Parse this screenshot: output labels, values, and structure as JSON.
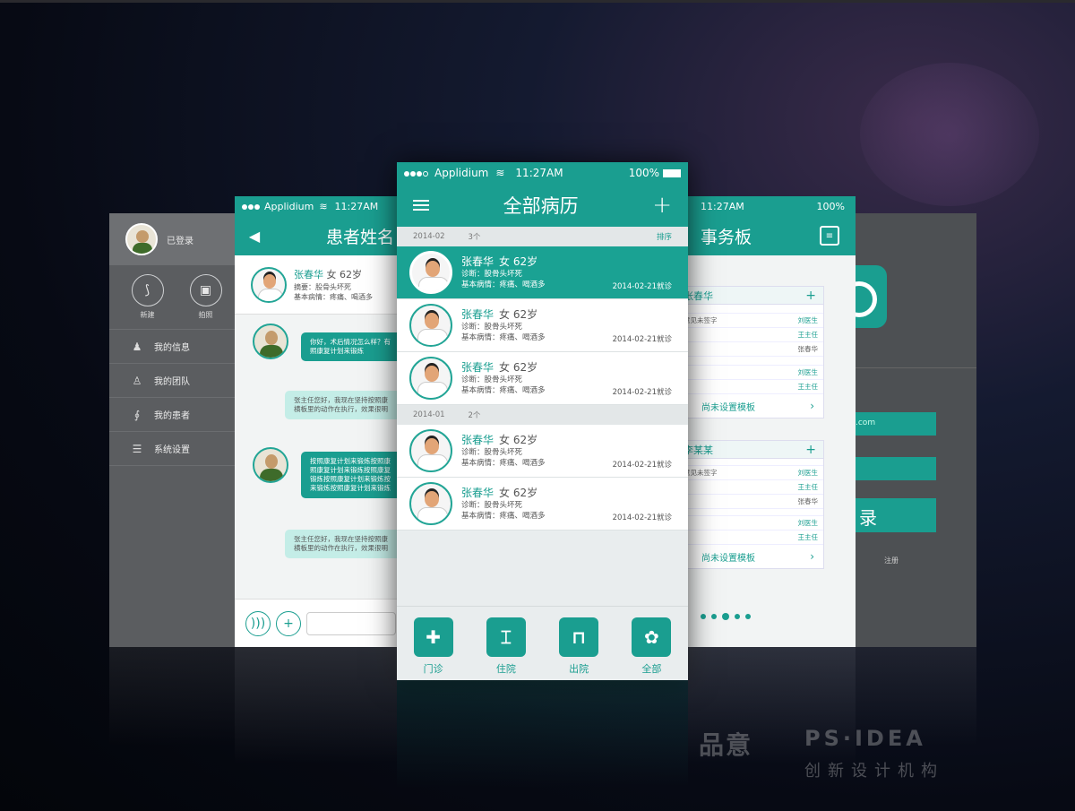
{
  "status": {
    "carrier": "Applidium",
    "time": "11:27AM",
    "battery": "100%"
  },
  "left_menu": {
    "login_label": "已登录",
    "quick": [
      {
        "label": "新建",
        "icon": "route-icon"
      },
      {
        "label": "拍照",
        "icon": "camera-icon"
      }
    ],
    "items": [
      {
        "label": "我的信息",
        "icon": "user-icon"
      },
      {
        "label": "我的团队",
        "icon": "team-icon"
      },
      {
        "label": "我的患者",
        "icon": "stethoscope-icon"
      },
      {
        "label": "系统设置",
        "icon": "settings-icon"
      }
    ]
  },
  "chat": {
    "title": "患者姓名",
    "patient": {
      "name": "张春华",
      "gender_age": "女 62岁",
      "summary": "摘要：股骨头坏死",
      "condition": "基本病情：疼痛、喝酒多"
    },
    "messages": [
      {
        "dir": "in",
        "lines": [
          "你好，术后情况怎么样？有",
          "照康复计划来锻炼"
        ]
      },
      {
        "dir": "out",
        "lines": [
          "张主任您好，我现在坚持按照康",
          "横板里的动作在执行，效果很明"
        ]
      },
      {
        "dir": "in",
        "lines": [
          "按照康复计划来锻炼按照康",
          "照康复计划来锻炼按照康复",
          "锻炼按照康复计划来锻炼按",
          "来锻炼按照康复计划来锻炼"
        ]
      },
      {
        "dir": "out",
        "lines": [
          "张主任您好，我现在坚持按照康",
          "横板里的动作在执行，效果很明"
        ]
      }
    ]
  },
  "main": {
    "title": "全部病历",
    "sections": [
      {
        "date": "2014-02",
        "count": "3个",
        "sort": "排序",
        "records": [
          {
            "name": "张春华",
            "ga": "女  62岁",
            "diag": "诊断：股骨头坏死",
            "cond": "基本病情：疼痛、喝酒多",
            "date": "2014-02-21就诊"
          },
          {
            "name": "张春华",
            "ga": "女  62岁",
            "diag": "诊断：股骨头坏死",
            "cond": "基本病情：疼痛、喝酒多",
            "date": "2014-02-21就诊"
          },
          {
            "name": "张春华",
            "ga": "女  62岁",
            "diag": "诊断：股骨头坏死",
            "cond": "基本病情：疼痛、喝酒多",
            "date": "2014-02-21就诊"
          }
        ]
      },
      {
        "date": "2014-01",
        "count": "2个",
        "sort": "",
        "records": [
          {
            "name": "张春华",
            "ga": "女  62岁",
            "diag": "诊断：股骨头坏死",
            "cond": "基本病情：疼痛、喝酒多",
            "date": "2014-02-21就诊"
          },
          {
            "name": "张春华",
            "ga": "女  62岁",
            "diag": "诊断：股骨头坏死",
            "cond": "基本病情：疼痛、喝酒多",
            "date": "2014-02-21就诊"
          }
        ]
      }
    ],
    "tabs": [
      {
        "label": "门诊",
        "icon": "medkit-icon",
        "glyph": "✚"
      },
      {
        "label": "住院",
        "icon": "bed-plus-icon",
        "glyph": "⌶"
      },
      {
        "label": "出院",
        "icon": "bed-icon",
        "glyph": "⊓"
      },
      {
        "label": "全部",
        "icon": "flower-icon",
        "glyph": "✿"
      }
    ]
  },
  "board": {
    "title": "事务板",
    "cards": [
      {
        "name": "张春华",
        "rows": [
          [
            "意见未签字",
            "刘医生"
          ],
          [
            "",
            "王主任"
          ],
          [
            "",
            "张春华"
          ],
          [
            "",
            "刘医生"
          ],
          [
            "",
            "王主任"
          ]
        ],
        "footer": "尚未设置模板"
      },
      {
        "name": "李某某",
        "rows": [
          [
            "意见未签字",
            "刘医生"
          ],
          [
            "",
            "王主任"
          ],
          [
            "",
            "张春华"
          ],
          [
            "",
            "刘医生"
          ],
          [
            "",
            "王主任"
          ]
        ],
        "footer": "尚未设置模板"
      }
    ]
  },
  "login": {
    "field1": ".com",
    "button": "录",
    "register": "注册"
  },
  "watermark": {
    "logo": "品意",
    "brand": "PS·IDEA",
    "slogan": "创新设计机构"
  }
}
